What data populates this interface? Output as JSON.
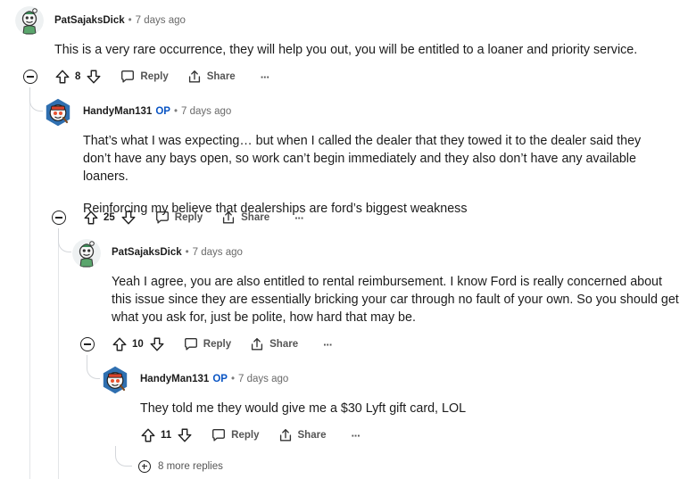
{
  "comments": [
    {
      "author": "PatSajaksDick",
      "op_badge": "",
      "time": "7 days ago",
      "paragraphs": [
        "This is a very rare occurrence, they will help you out, you will be entitled to a loaner and priority service."
      ],
      "score": "8"
    },
    {
      "author": "HandyMan131",
      "op_badge": "OP",
      "time": "7 days ago",
      "paragraphs": [
        "That’s what I was expecting… but when I called the dealer that they towed it to the dealer said they don’t have any bays open, so work can’t begin immediately and they also don’t have any available loaners.",
        "Reinforcing my believe that dealerships are ford’s biggest weakness"
      ],
      "score": "25"
    },
    {
      "author": "PatSajaksDick",
      "op_badge": "",
      "time": "7 days ago",
      "paragraphs": [
        "Yeah I agree, you are also entitled to rental reimbursement. I know Ford is really concerned about this issue since they are essentially bricking your car through no fault of your own. So you should get what you ask for, just be polite, how hard that may be."
      ],
      "score": "10"
    },
    {
      "author": "HandyMan131",
      "op_badge": "OP",
      "time": "7 days ago",
      "paragraphs": [
        "They told me they would give me a $30 Lyft gift card, LOL"
      ],
      "score": "11"
    }
  ],
  "actions": {
    "reply": "Reply",
    "share": "Share",
    "more": "···"
  },
  "separator": "•",
  "more_replies": "8 more replies",
  "colors": {
    "op": "#0a55c4",
    "thread": "#e3e5e8",
    "text": "#1c1c1c"
  },
  "icons": [
    "upvote-icon",
    "downvote-icon",
    "reply-icon",
    "share-icon",
    "collapse-icon",
    "expand-icon",
    "more-icon"
  ]
}
